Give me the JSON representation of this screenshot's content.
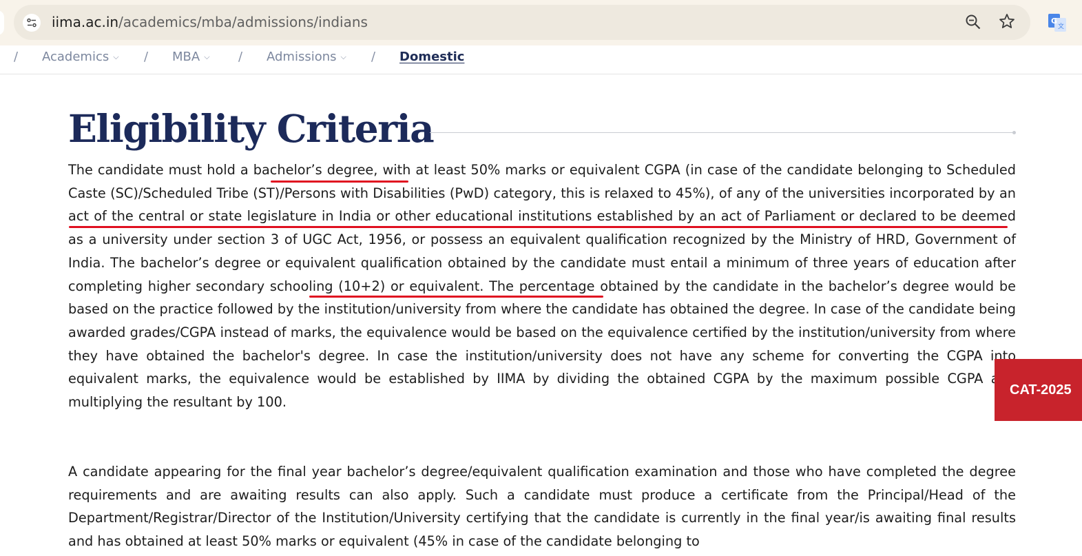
{
  "browser": {
    "url_host": "iima.ac.in",
    "url_path": "/academics/mba/admissions/indians",
    "icons": [
      "site-info-icon",
      "zoom-icon",
      "bookmark-star-icon",
      "google-translate-icon"
    ]
  },
  "breadcrumb": {
    "separator": "/",
    "items": [
      {
        "label": "Academics",
        "has_dropdown": true
      },
      {
        "label": "MBA",
        "has_dropdown": true
      },
      {
        "label": "Admissions",
        "has_dropdown": true
      },
      {
        "label": "Domestic",
        "has_dropdown": false,
        "current": true
      }
    ]
  },
  "section": {
    "heading": "Eligibility Criteria",
    "paragraph1": "The candidate must hold a bachelor’s degree, with at least 50% marks or equivalent CGPA (in case of the candidate belonging to Scheduled Caste (SC)/Scheduled Tribe (ST)/Persons with Disabilities (PwD) category, this is relaxed to 45%), of any of the universities incorporated by an act of the central or state legislature in India or other educational institutions established by an act of Parliament or declared to be deemed as a university under section 3 of UGC Act, 1956, or possess an equivalent qualification recognized by the Ministry of HRD, Government of India. The bachelor’s degree or equivalent qualification obtained by the candidate must entail a minimum of three years of education after completing higher secondary schooling (10+2) or equivalent. The percentage obtained by the candidate in the bachelor’s degree would be based on the practice followed by the institution/university from where the candidate has obtained the degree. In case of the candidate being awarded grades/CGPA instead of marks, the equivalence would be based on the equivalence certified by the institution/university from where they have obtained the bachelor's degree. In case the institution/university does not have any scheme for converting the CGPA into equivalent marks, the equivalence would be established by IIMA by dividing the obtained CGPA by the maximum possible CGPA and multiplying the resultant by 100.",
    "paragraph2": "A candidate appearing for the final year bachelor’s degree/equivalent qualification examination and those who have completed the degree requirements and are awaiting results can also apply. Such a candidate must produce a certificate from the Principal/Head of the Department/Registrar/Director of the Institution/University certifying that the candidate is currently in the final year/is awaiting final results and has obtained at least 50% marks or equivalent (45% in case of the candidate belonging to"
  },
  "cat_tab": {
    "label": "CAT-2025"
  },
  "colors": {
    "heading": "#1c2a5a",
    "annotation_red": "#e01020",
    "cat_tab_bg": "#c8232c",
    "breadcrumb_text": "#7c879e"
  }
}
